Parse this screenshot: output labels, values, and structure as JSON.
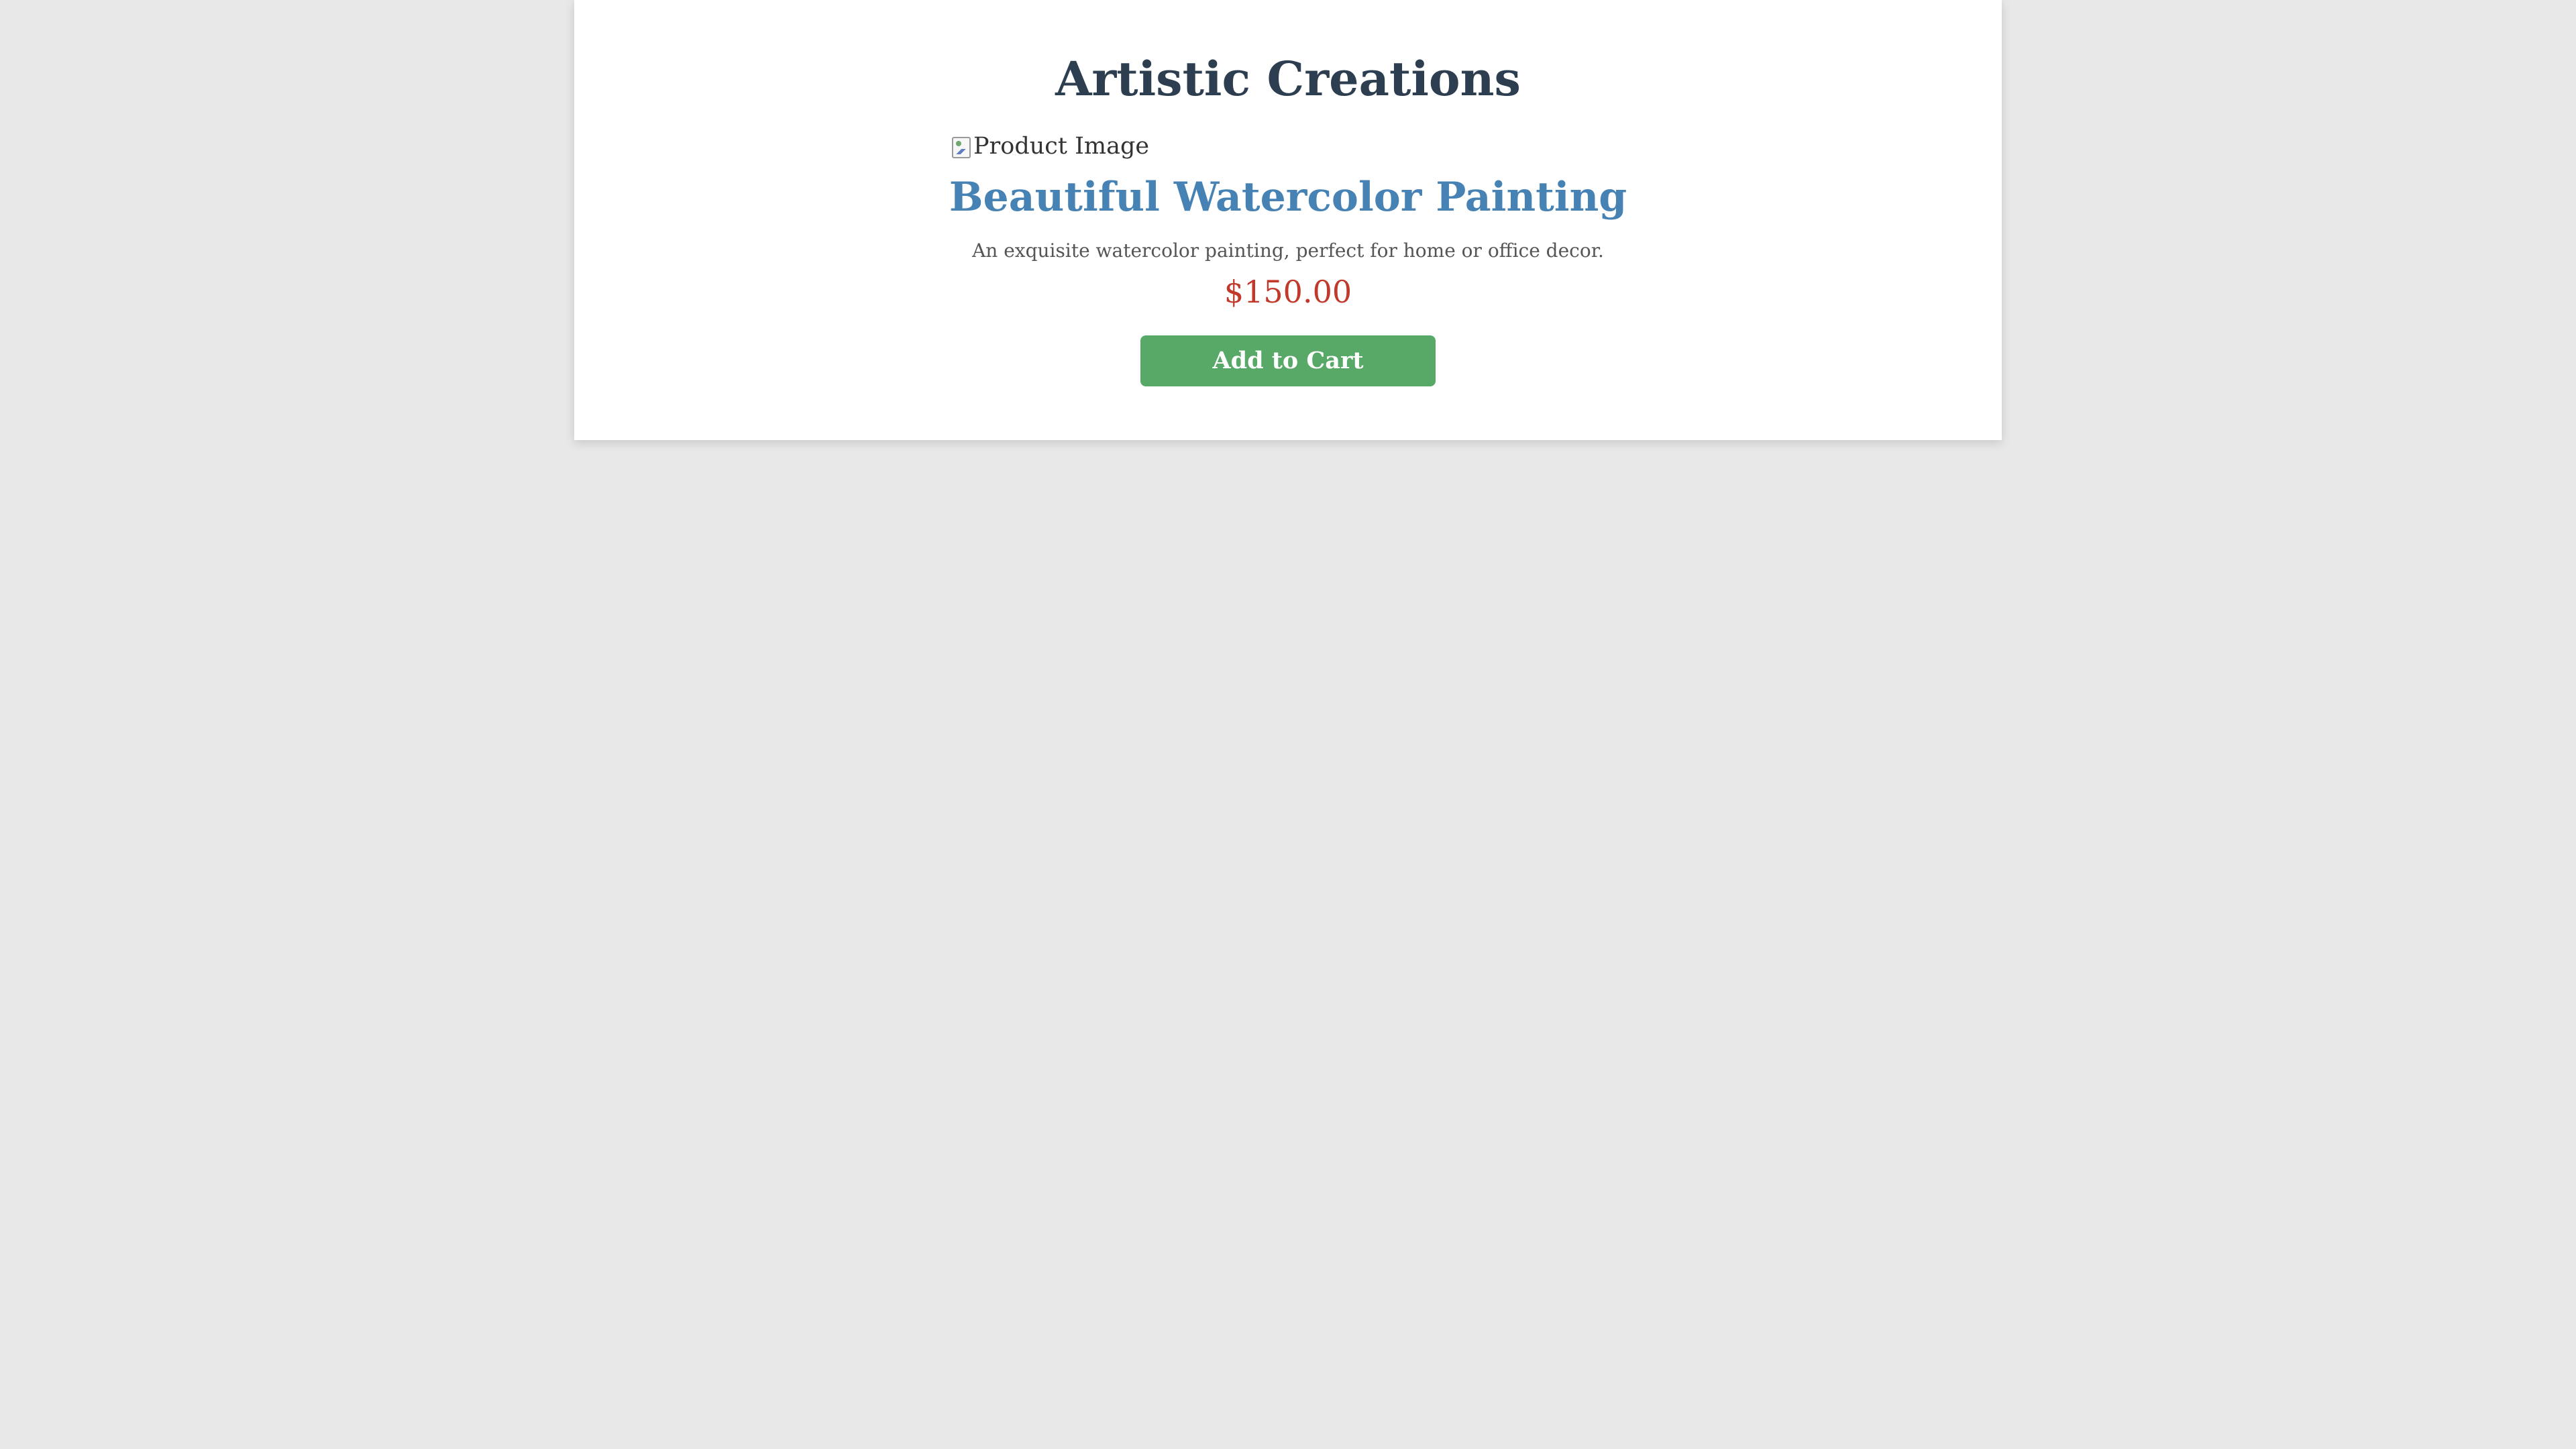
{
  "page": {
    "store_title": "Artistic Creations"
  },
  "product": {
    "image_alt": "Product Image",
    "image_icon": "broken-image-icon",
    "name": "Beautiful Watercolor Painting",
    "description": "An exquisite watercolor painting, perfect for home or office decor.",
    "price": "$150.00",
    "button_label": "Add to Cart"
  },
  "colors": {
    "page_background": "#e8e8e8",
    "card_background": "#ffffff",
    "store_title": "#2c3e50",
    "product_name": "#4682b4",
    "description": "#555555",
    "price": "#c0392b",
    "button_background": "#58a967",
    "button_text": "#ffffff"
  }
}
